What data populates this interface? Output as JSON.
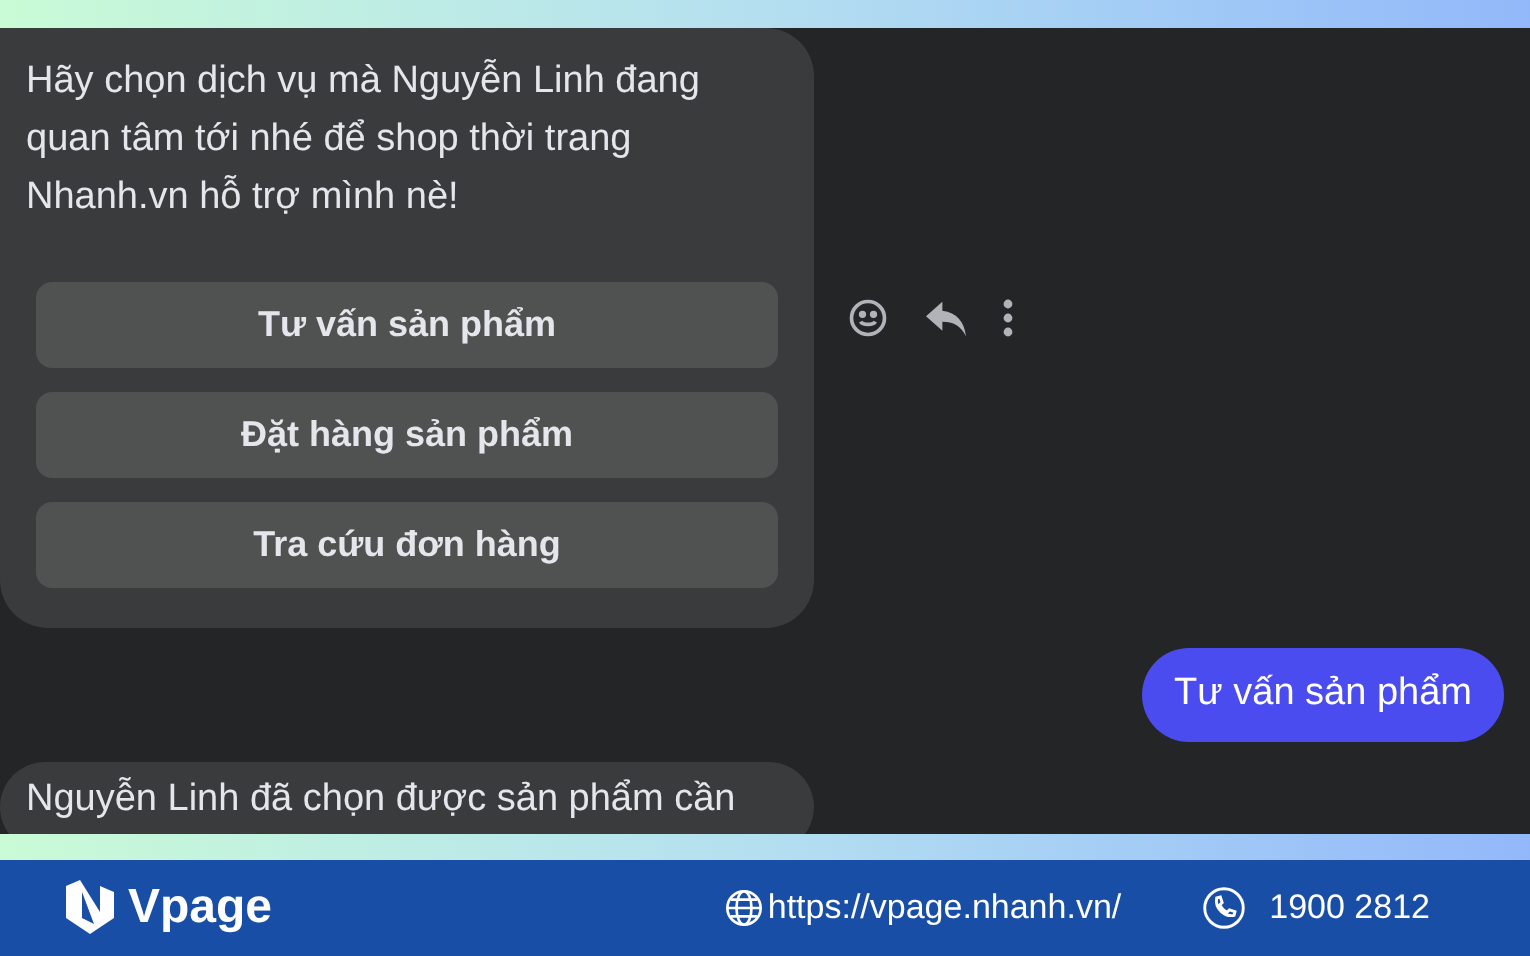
{
  "messages": [
    {
      "kind": "incoming",
      "text": "Hãy chọn dịch vụ mà Nguyễn Linh đang quan tâm tới nhé để shop thời trang Nhanh.vn hỗ trợ mình nè!",
      "buttons": [
        "Tư vấn sản phẩm",
        "Đặt hàng sản phẩm",
        "Tra cứu đơn hàng"
      ]
    },
    {
      "kind": "outgoing",
      "text": "Tư vấn sản phẩm"
    },
    {
      "kind": "incoming",
      "text": "Nguyễn Linh đã chọn được sản phẩm cần"
    }
  ],
  "footer": {
    "brand": "Vpage",
    "url": "https://vpage.nhanh.vn/",
    "phone": "1900 2812"
  }
}
